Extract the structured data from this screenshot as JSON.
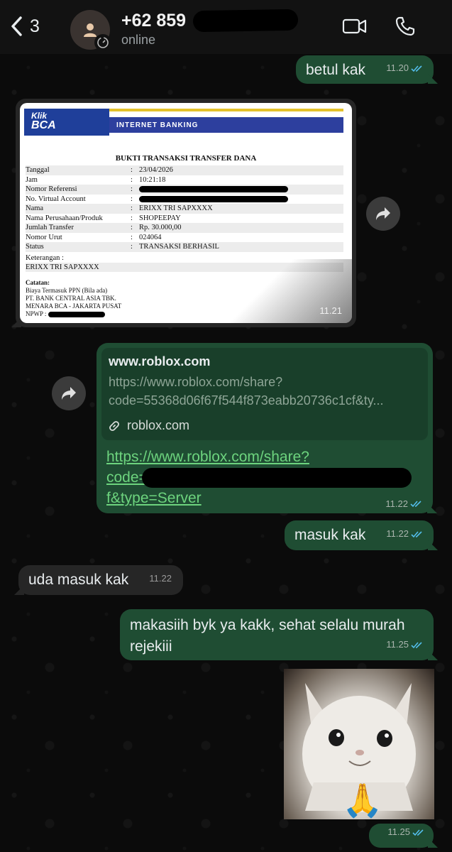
{
  "header": {
    "back_count": "3",
    "contact_name": "+62 859",
    "status": "online"
  },
  "messages": {
    "m1": {
      "text": "betul kak",
      "time": "11.20"
    },
    "receipt": {
      "time": "11.21",
      "logo_line1": "Klik",
      "logo_line2": "BCA",
      "banner": "INTERNET BANKING",
      "title": "BUKTI TRANSAKSI TRANSFER DANA",
      "rows": [
        {
          "k": "Tanggal",
          "v": "23/04/2026"
        },
        {
          "k": "Jam",
          "v": "10:21:18"
        },
        {
          "k": "Nomor Referensi",
          "v": ""
        },
        {
          "k": "No. Virtual Account",
          "v": ""
        },
        {
          "k": "Nama",
          "v": "ERIXX TRI SAPXXXX"
        },
        {
          "k": "Nama Perusahaan/Produk",
          "v": "SHOPEEPAY"
        },
        {
          "k": "Jumlah Transfer",
          "v": "Rp. 30.000,00"
        },
        {
          "k": "Nomor Urut",
          "v": "024064"
        },
        {
          "k": "Status",
          "v": "TRANSAKSI BERHASIL"
        }
      ],
      "ket_label": "Keterangan :",
      "ket_value": "ERIXX TRI SAPXXXX",
      "notes_title": "Catatan:",
      "notes": [
        "Biaya Termasuk PPN (Bila ada)",
        "PT. BANK CENTRAL ASIA TBK.",
        "MENARA BCA - JAKARTA PUSAT"
      ],
      "npwp": "NPWP :"
    },
    "link": {
      "site": "www.roblox.com",
      "desc_line1": "https://www.roblox.com/share?",
      "desc_line2": "code=55368d06f67f544f873eabb20736c1cf&ty...",
      "domain": "roblox.com",
      "text_line1": "https://www.roblox.com/share?",
      "text_line2": "code=",
      "text_line3": "f&type=Server",
      "time": "11.22"
    },
    "m3": {
      "text": "masuk kak",
      "time": "11.22"
    },
    "m4": {
      "text": "uda masuk kak",
      "time": "11.22"
    },
    "m5": {
      "text": "makasiih byk ya kakk, sehat selalu murah rejekiii",
      "time": "11.25"
    },
    "m6": {
      "emoji": "🙏",
      "time": "11.25"
    }
  },
  "colors": {
    "outgoing": "#1f4d33",
    "incoming": "#262626",
    "link": "#6dd47e",
    "read_ticks": "#53bdeb"
  }
}
